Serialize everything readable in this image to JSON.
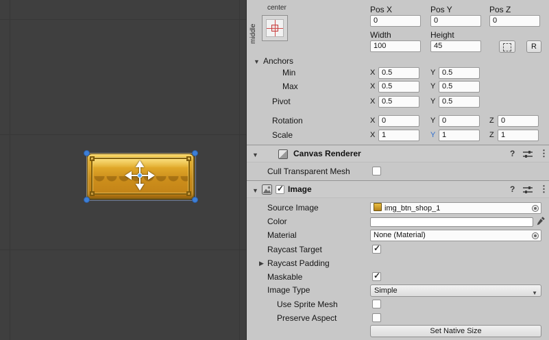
{
  "icons": {
    "help": "?",
    "kebab": "⋮",
    "foldout_open": "▼",
    "foldout_closed": "▶",
    "dropdown": "▼"
  },
  "colors": {
    "scene_background": "#3f3f3f",
    "sprite_gold": "#d89a1e",
    "selection_handle_blue": "#3d7fd6",
    "scale_y_axis_highlight": "#2f6fce"
  },
  "inspector": {
    "rect": {
      "anchor_h": "center",
      "anchor_v": "middle",
      "pos_x_label": "Pos X",
      "pos_y_label": "Pos Y",
      "pos_z_label": "Pos Z",
      "pos_x": "0",
      "pos_y": "0",
      "pos_z": "0",
      "width_label": "Width",
      "height_label": "Height",
      "width": "100",
      "height": "45",
      "r_button_label": "R",
      "anchors_label": "Anchors",
      "min_label": "Min",
      "max_label": "Max",
      "axis_x": "X",
      "axis_y": "Y",
      "axis_z": "Z",
      "anchors_min_x": "0.5",
      "anchors_min_y": "0.5",
      "anchors_max_x": "0.5",
      "anchors_max_y": "0.5",
      "pivot_label": "Pivot",
      "pivot_x": "0.5",
      "pivot_y": "0.5",
      "rotation_label": "Rotation",
      "rotation_x": "0",
      "rotation_y": "0",
      "rotation_z": "0",
      "scale_label": "Scale",
      "scale_x": "1",
      "scale_y": "1",
      "scale_z": "1"
    },
    "canvas_renderer": {
      "title": "Canvas Renderer",
      "cull_transparent_mesh_label": "Cull Transparent Mesh",
      "cull_transparent_mesh_checked": false
    },
    "image": {
      "title": "Image",
      "enabled": true,
      "source_image_label": "Source Image",
      "source_image_value": "img_btn_shop_1",
      "color_label": "Color",
      "material_label": "Material",
      "material_value": "None (Material)",
      "raycast_target_label": "Raycast Target",
      "raycast_target_checked": true,
      "raycast_padding_label": "Raycast Padding",
      "maskable_label": "Maskable",
      "maskable_checked": true,
      "image_type_label": "Image Type",
      "image_type_value": "Simple",
      "use_sprite_mesh_label": "Use Sprite Mesh",
      "use_sprite_mesh_checked": false,
      "preserve_aspect_label": "Preserve Aspect",
      "preserve_aspect_checked": false,
      "set_native_size_label": "Set Native Size"
    }
  }
}
